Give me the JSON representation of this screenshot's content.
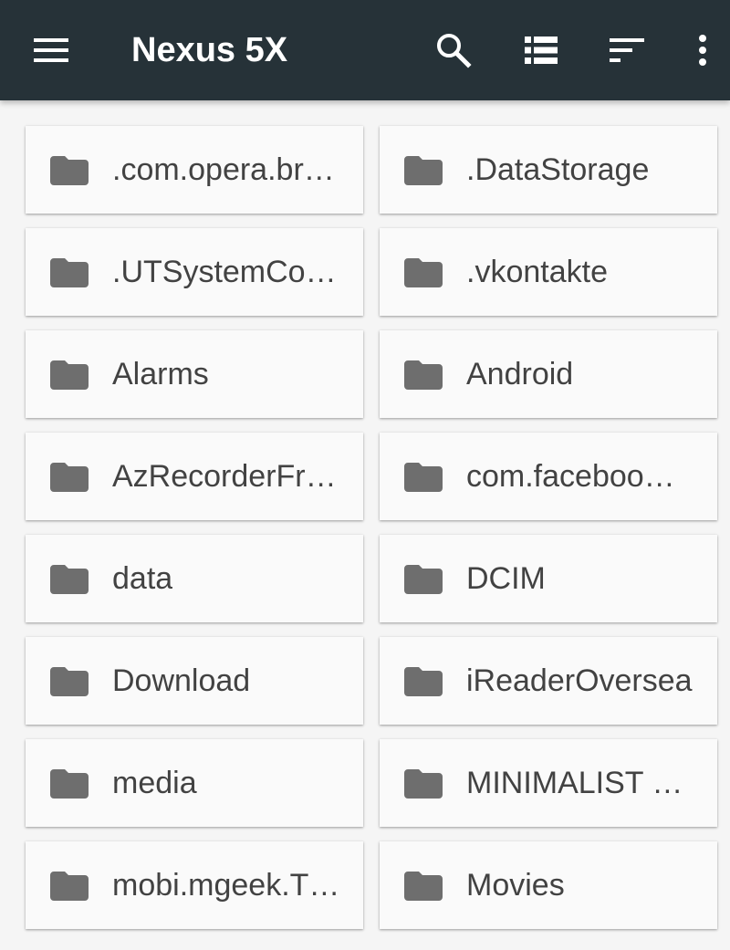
{
  "app_bar": {
    "title": "Nexus 5X",
    "background_color": "#263238",
    "menu_icon": "hamburger-menu-icon",
    "actions": [
      {
        "icon": "search-icon"
      },
      {
        "icon": "list-view-icon"
      },
      {
        "icon": "sort-icon"
      },
      {
        "icon": "more-vert-icon"
      }
    ]
  },
  "folders": [
    {
      "name": ".com.opera.br…",
      "icon": "folder-icon"
    },
    {
      "name": ".DataStorage",
      "icon": "folder-icon"
    },
    {
      "name": ".UTSystemCo…",
      "icon": "folder-icon"
    },
    {
      "name": ".vkontakte",
      "icon": "folder-icon"
    },
    {
      "name": "Alarms",
      "icon": "folder-icon"
    },
    {
      "name": "Android",
      "icon": "folder-icon"
    },
    {
      "name": "AzRecorderFr…",
      "icon": "folder-icon"
    },
    {
      "name": "com.faceboo…",
      "icon": "folder-icon"
    },
    {
      "name": "data",
      "icon": "folder-icon"
    },
    {
      "name": "DCIM",
      "icon": "folder-icon"
    },
    {
      "name": "Download",
      "icon": "folder-icon"
    },
    {
      "name": "iReaderOversea",
      "icon": "folder-icon"
    },
    {
      "name": "media",
      "icon": "folder-icon"
    },
    {
      "name": "MINIMALIST …",
      "icon": "folder-icon"
    },
    {
      "name": "mobi.mgeek.T…",
      "icon": "folder-icon"
    },
    {
      "name": "Movies",
      "icon": "folder-icon"
    }
  ],
  "colors": {
    "folder_icon": "#6e6e6e",
    "folder_text": "#424242",
    "tile_background": "#fafafa"
  }
}
